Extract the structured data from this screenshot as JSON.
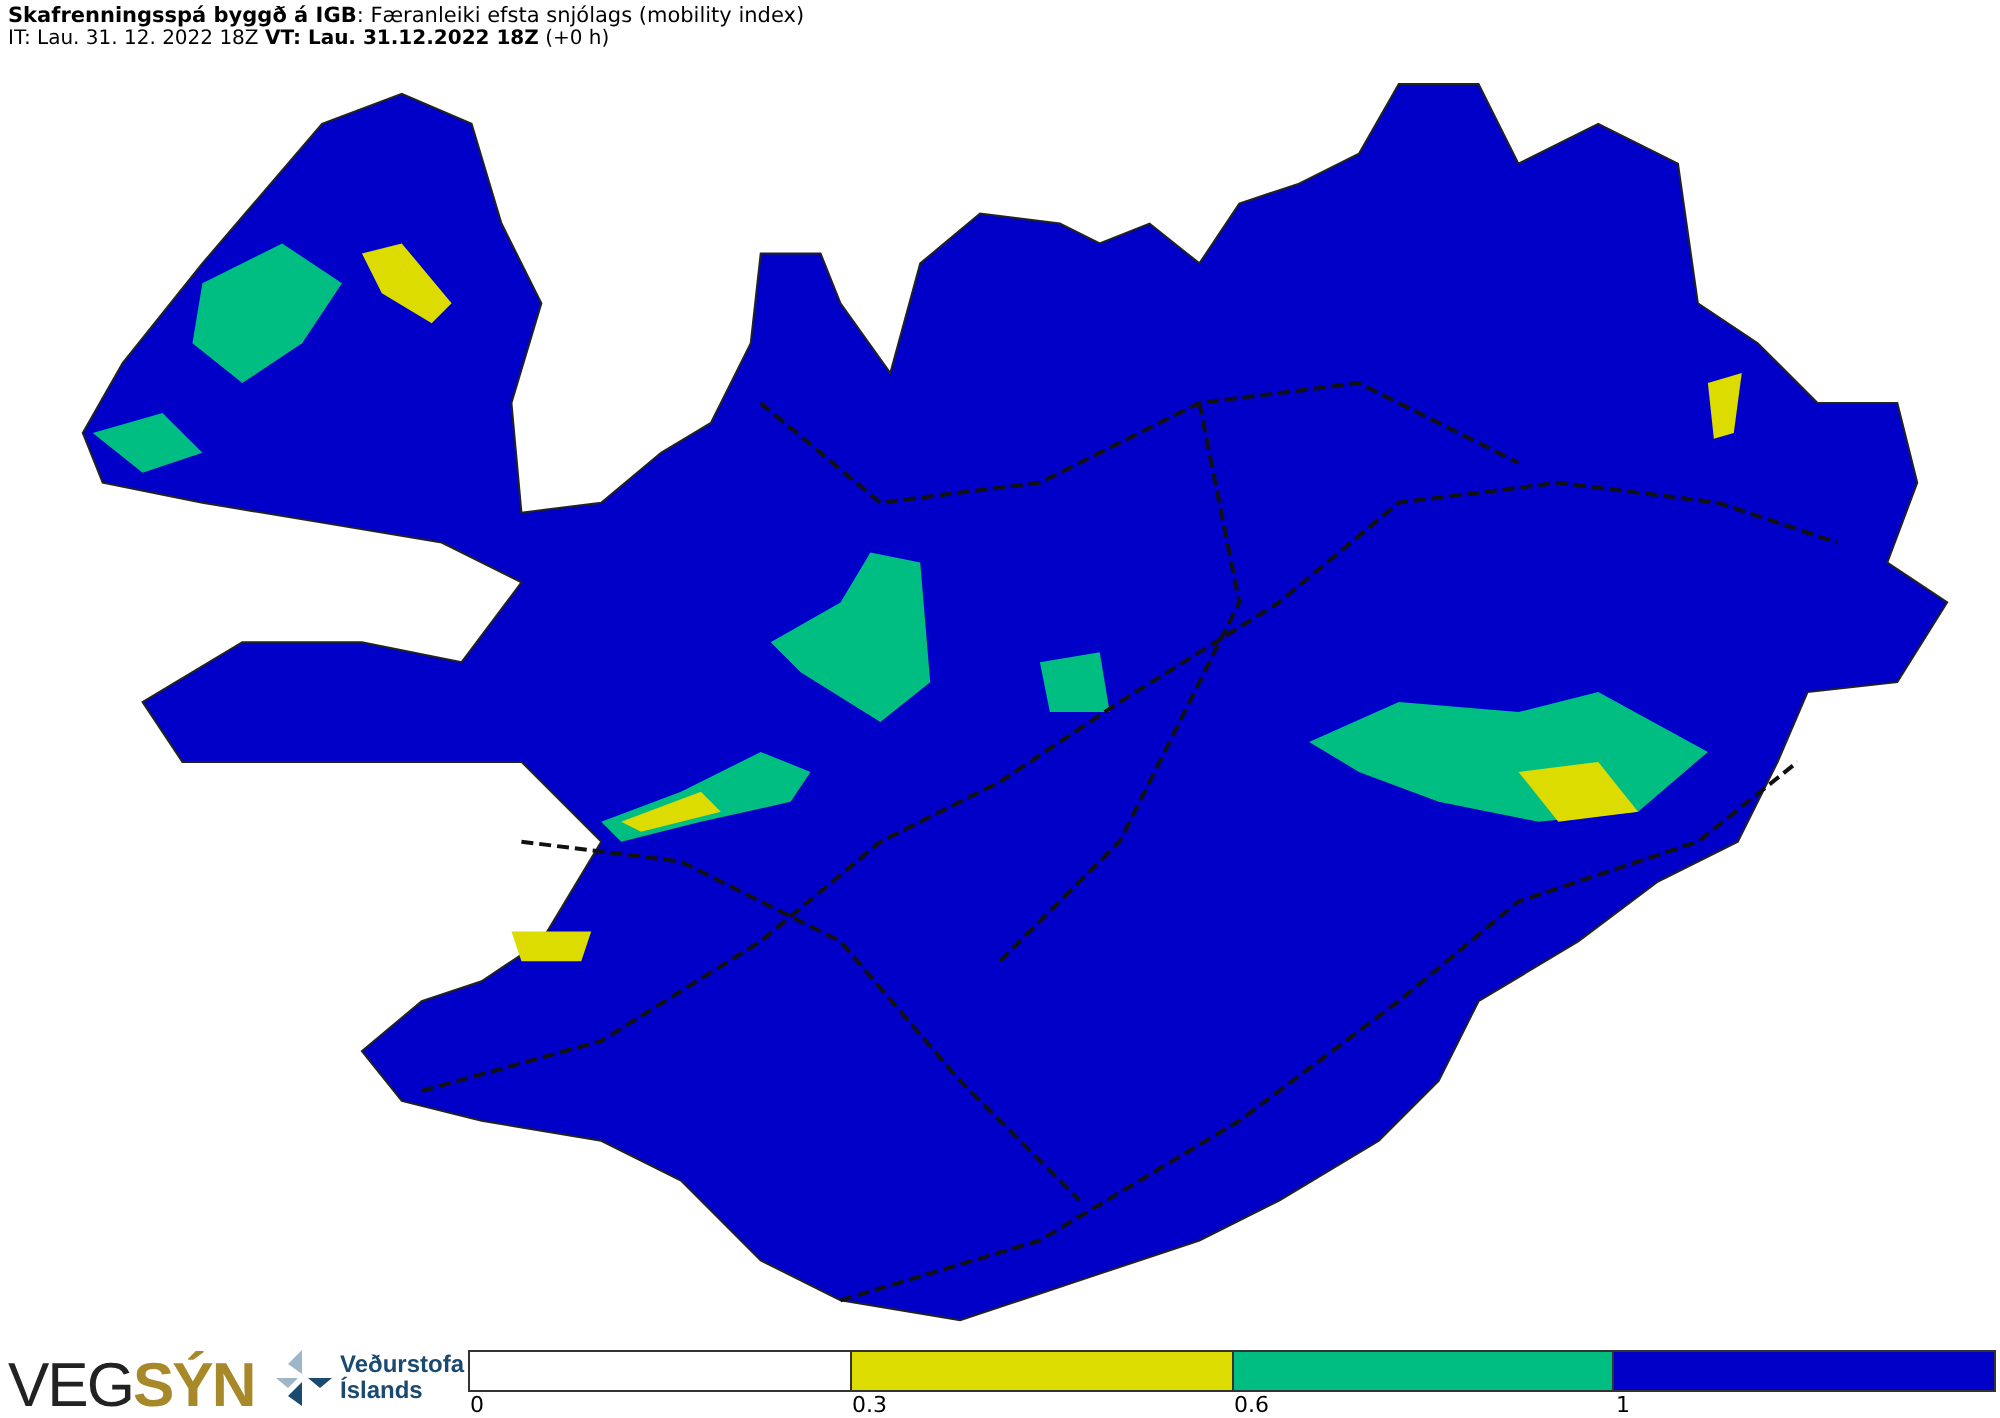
{
  "header": {
    "title": "**Skafrenningsspá byggð á IGB**: Færanleiki efsta snjólags (mobility index)",
    "times": "IT: Lau. 31. 12. 2022 18Z **VT: Lau. 31.12.2022 18Z** (+0 h)"
  },
  "logos": {
    "vegsyn": "VEG**SÝN**",
    "vedur_line1": "Veðurstofa",
    "vedur_line2": "Íslands"
  },
  "legend": {
    "segments": [
      {
        "color": "#ffffff",
        "tick": "0"
      },
      {
        "color": "#dcdc00",
        "tick": "0.3"
      },
      {
        "color": "#00be82",
        "tick": "0.6"
      },
      {
        "color": "#0000c8",
        "tick": "1"
      }
    ]
  }
}
